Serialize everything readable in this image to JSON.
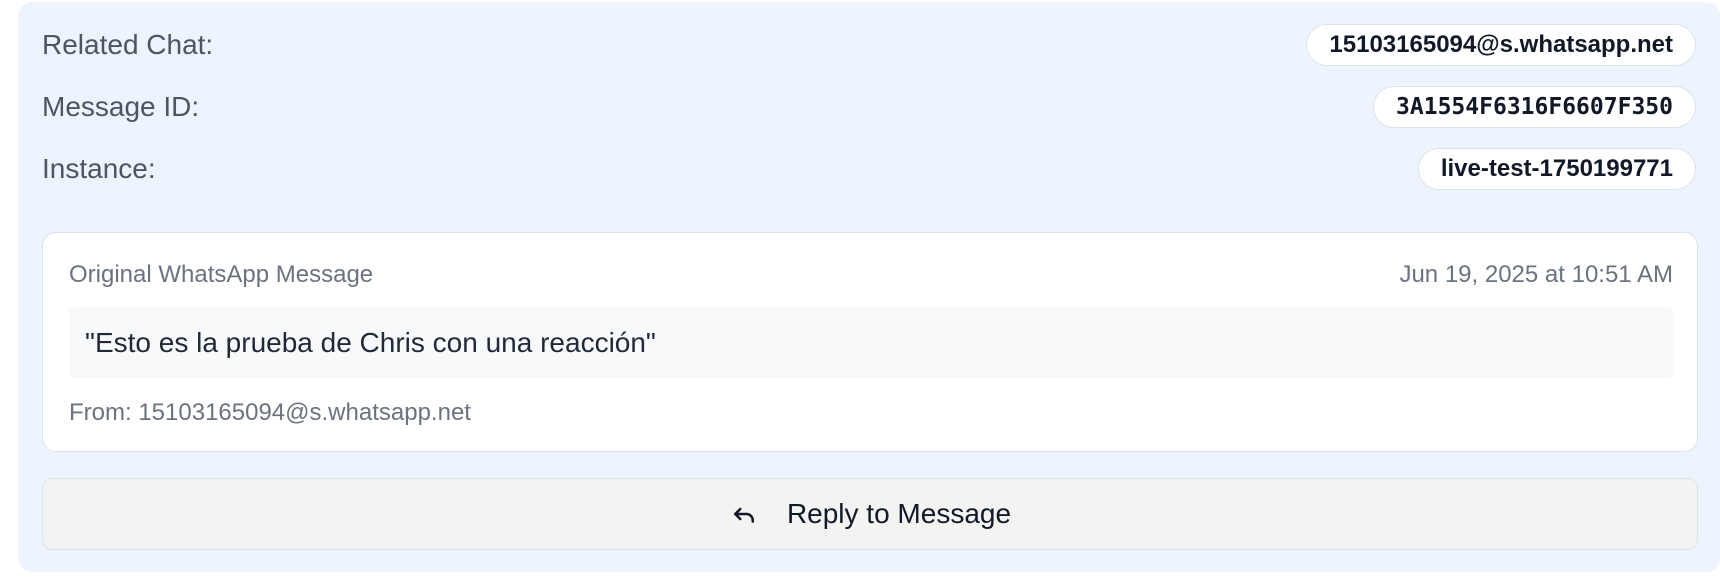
{
  "details": {
    "related_chat_label": "Related Chat:",
    "related_chat_value": "15103165094@s.whatsapp.net",
    "message_id_label": "Message ID:",
    "message_id_value": "3A1554F6316F6607F350",
    "instance_label": "Instance:",
    "instance_value": "live-test-1750199771"
  },
  "original_message": {
    "title": "Original WhatsApp Message",
    "timestamp": "Jun 19, 2025 at 10:51 AM",
    "text": "\"Esto es la prueba de Chris con una reacción\"",
    "from": "From: 15103165094@s.whatsapp.net"
  },
  "reply_button": {
    "label": "Reply to Message",
    "icon": "reply-arrow-icon"
  },
  "colors": {
    "panel_bg": "#eef4fd",
    "card_bg": "#ffffff",
    "button_bg": "#f3f3f1",
    "muted_text": "#6b7280"
  }
}
